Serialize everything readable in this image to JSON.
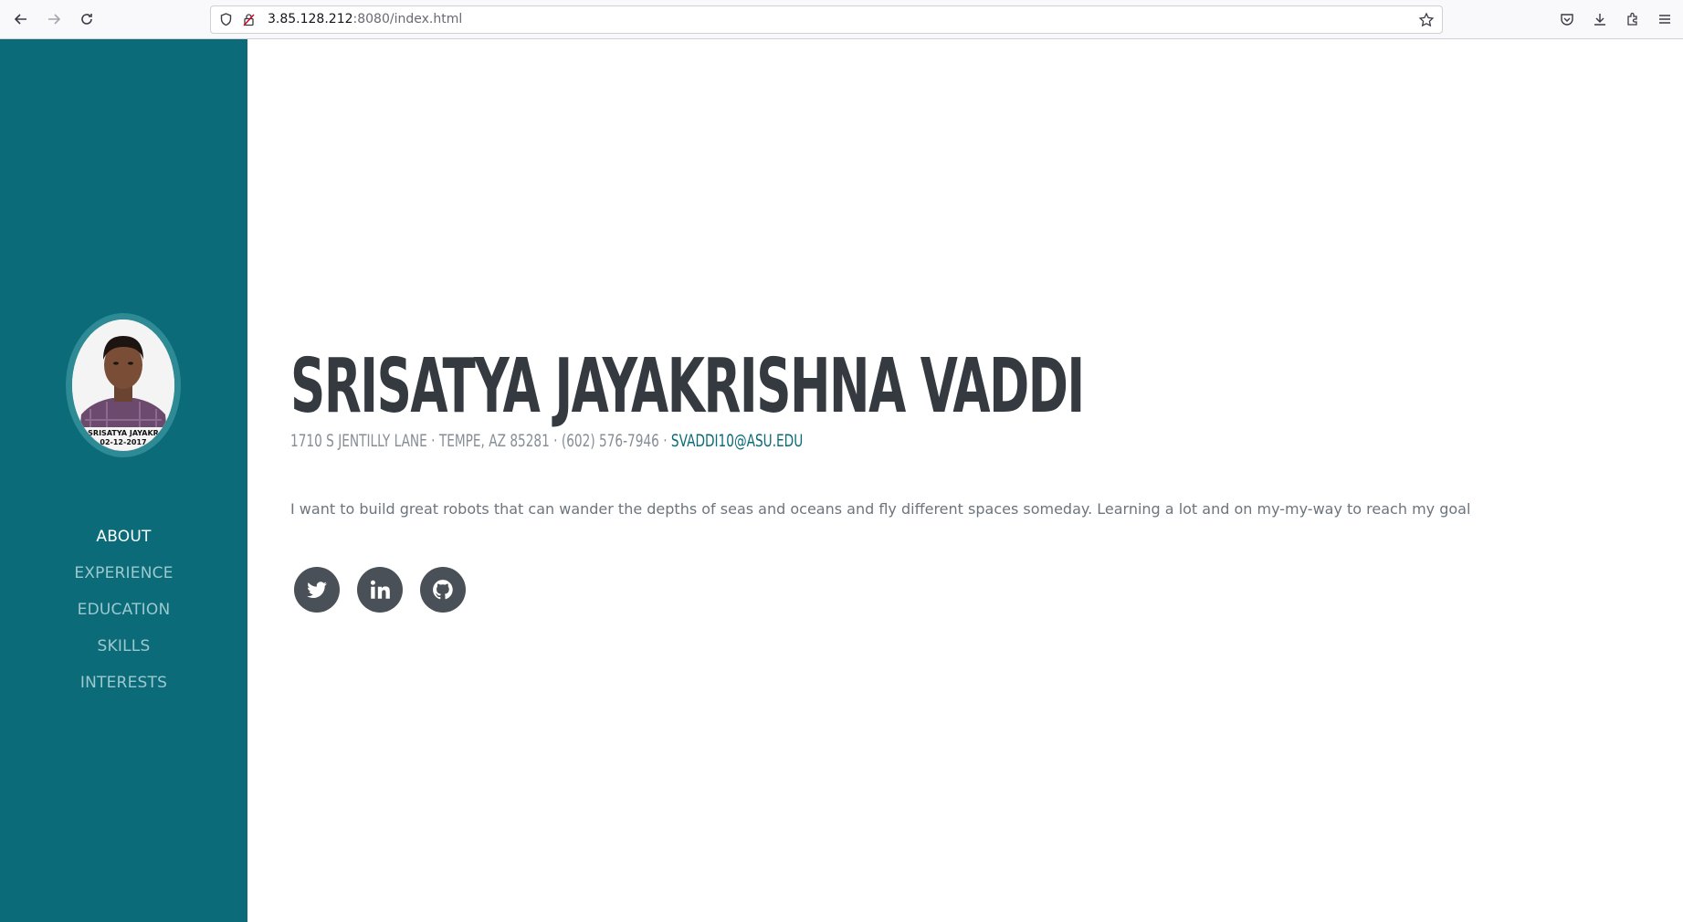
{
  "browser": {
    "url_host": "3.85.128.212",
    "url_rest": ":8080/index.html"
  },
  "sidebar": {
    "items": [
      {
        "label": "ABOUT",
        "active": true
      },
      {
        "label": "EXPERIENCE",
        "active": false
      },
      {
        "label": "EDUCATION",
        "active": false
      },
      {
        "label": "SKILLS",
        "active": false
      },
      {
        "label": "INTERESTS",
        "active": false
      }
    ],
    "avatar_caption": "SRISATYA JAYAKR",
    "avatar_date": "02-12-2017"
  },
  "main": {
    "name": "SRISATYA JAYAKRISHNA VADDI",
    "contact_prefix": "1710 S JENTILLY LANE · TEMPE, AZ 85281 · (602) 576-7946 · ",
    "email": "SVADDI10@ASU.EDU",
    "bio": "I want to build great robots that can wander the depths of seas and oceans and fly different spaces someday. Learning a lot and on my-my-way to reach my goal"
  },
  "social": [
    {
      "icon": "twitter-icon"
    },
    {
      "icon": "linkedin-icon"
    },
    {
      "icon": "github-icon"
    }
  ],
  "colors": {
    "sidebar": "#0b6b78",
    "heading": "#343a40",
    "accent": "#0b6b78",
    "social_bg": "#495057"
  }
}
